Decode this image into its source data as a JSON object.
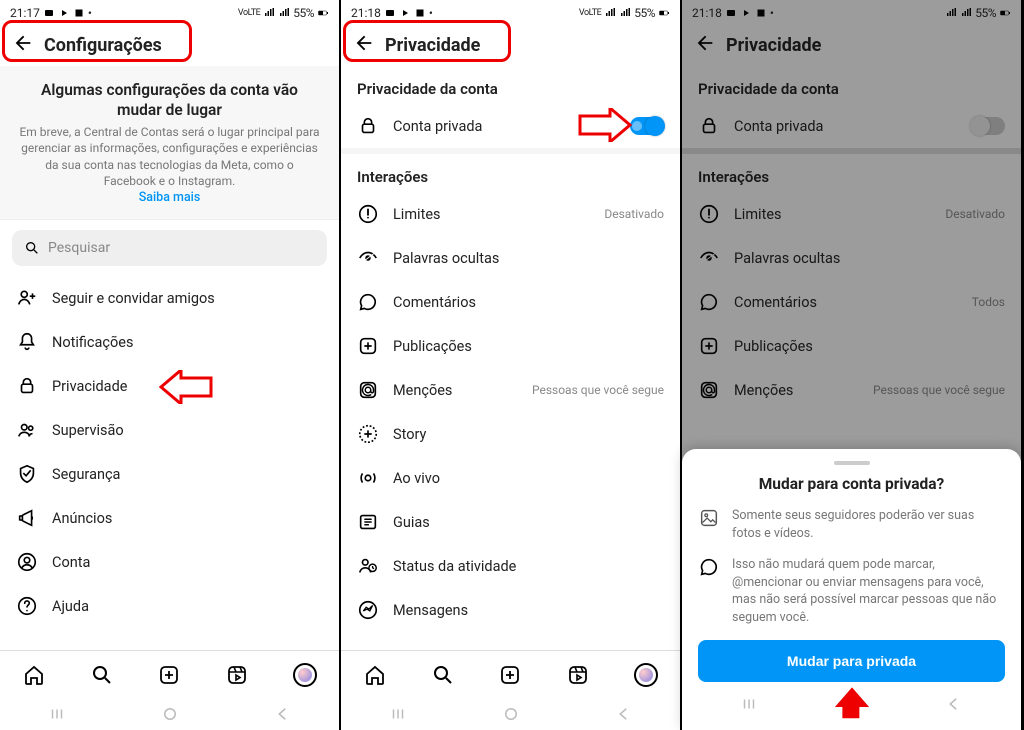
{
  "status": {
    "time1": "21:17",
    "time2": "21:18",
    "time3": "21:18",
    "net": "VoLTE",
    "batt": "55%",
    "batt_icon": "battery-icon"
  },
  "panel1": {
    "title": "Configurações",
    "notice_title": "Algumas configurações da conta vão mudar de lugar",
    "notice_body": "Em breve, a Central de Contas será o lugar principal para gerenciar as informações, configurações e experiências da sua conta nas tecnologias da Meta, como o Facebook e o Instagram.",
    "notice_link": "Saiba mais",
    "search_placeholder": "Pesquisar",
    "items": [
      {
        "icon": "user-plus-icon",
        "label": "Seguir e convidar amigos"
      },
      {
        "icon": "bell-icon",
        "label": "Notificações"
      },
      {
        "icon": "lock-icon",
        "label": "Privacidade"
      },
      {
        "icon": "people-icon",
        "label": "Supervisão"
      },
      {
        "icon": "shield-icon",
        "label": "Segurança"
      },
      {
        "icon": "megaphone-icon",
        "label": "Anúncios"
      },
      {
        "icon": "account-icon",
        "label": "Conta"
      },
      {
        "icon": "help-icon",
        "label": "Ajuda"
      }
    ]
  },
  "panel2": {
    "title": "Privacidade",
    "section1": "Privacidade da conta",
    "private_label": "Conta privada",
    "section2": "Interações",
    "items": [
      {
        "icon": "warn-circle-icon",
        "label": "Limites",
        "status": "Desativado"
      },
      {
        "icon": "eye-hidden-icon",
        "label": "Palavras ocultas",
        "status": ""
      },
      {
        "icon": "comment-icon",
        "label": "Comentários",
        "status": ""
      },
      {
        "icon": "plus-box-icon",
        "label": "Publicações",
        "status": ""
      },
      {
        "icon": "mention-icon",
        "label": "Menções",
        "status": "Pessoas que você segue"
      },
      {
        "icon": "plus-circle-icon",
        "label": "Story",
        "status": ""
      },
      {
        "icon": "live-icon",
        "label": "Ao vivo",
        "status": ""
      },
      {
        "icon": "guides-icon",
        "label": "Guias",
        "status": ""
      },
      {
        "icon": "activity-icon",
        "label": "Status da atividade",
        "status": ""
      },
      {
        "icon": "messenger-icon",
        "label": "Mensagens",
        "status": ""
      }
    ]
  },
  "panel3": {
    "title": "Privacidade",
    "section1": "Privacidade da conta",
    "private_label": "Conta privada",
    "section2": "Interações",
    "items": [
      {
        "icon": "warn-circle-icon",
        "label": "Limites",
        "status": "Desativado"
      },
      {
        "icon": "eye-hidden-icon",
        "label": "Palavras ocultas",
        "status": ""
      },
      {
        "icon": "comment-icon",
        "label": "Comentários",
        "status": "Todos"
      },
      {
        "icon": "plus-box-icon",
        "label": "Publicações",
        "status": ""
      },
      {
        "icon": "mention-icon",
        "label": "Menções",
        "status": "Pessoas que você segue"
      }
    ],
    "sheet_title": "Mudar para conta privada?",
    "sheet_info1": "Somente seus seguidores poderão ver suas fotos e vídeos.",
    "sheet_info2": "Isso não mudará quem pode marcar, @mencionar ou enviar mensagens para você, mas não será possível marcar pessoas que não seguem você.",
    "sheet_button": "Mudar para privada"
  }
}
